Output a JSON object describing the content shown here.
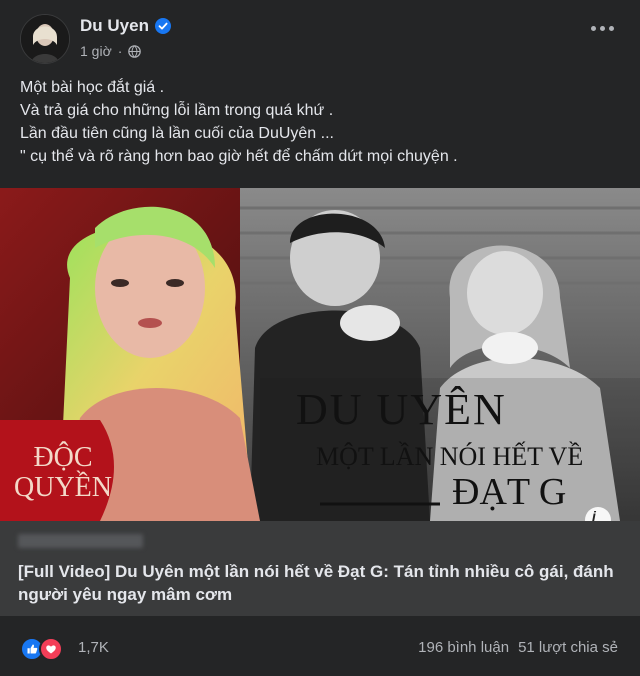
{
  "post": {
    "author": "Du Uyen",
    "time": "1 giờ",
    "privacy_icon": "globe-icon",
    "caption_lines": [
      "Một bài học đắt giá .",
      "Và trả giá cho những lỗi lầm trong quá khứ .",
      "Lần đầu tiên cũng là lần cuối của DuUyên ...",
      "\" cụ thể và rõ ràng hơn bao giờ hết để chấm dứt mọi chuyện ."
    ]
  },
  "media": {
    "badge": "ĐỘC QUYỀN",
    "headline_1": "DU UYÊN",
    "headline_2": "MỘT LẦN NÓI HẾT VỀ",
    "headline_3": "ĐẠT G",
    "info_icon": "i"
  },
  "link": {
    "title": "[Full Video] Du Uyên một lần nói hết về Đạt G: Tán tỉnh nhiều cô gái, đánh người yêu ngay mâm cơm"
  },
  "stats": {
    "reactions_count": "1,7K",
    "comments": "196 bình luận",
    "shares": "51 lượt chia sẻ"
  },
  "colors": {
    "background": "#242526",
    "link_box": "#3a3b3c",
    "verified": "#1877f2",
    "badge_red": "#b3121b",
    "like": "#1877f2",
    "love": "#f33e58"
  }
}
